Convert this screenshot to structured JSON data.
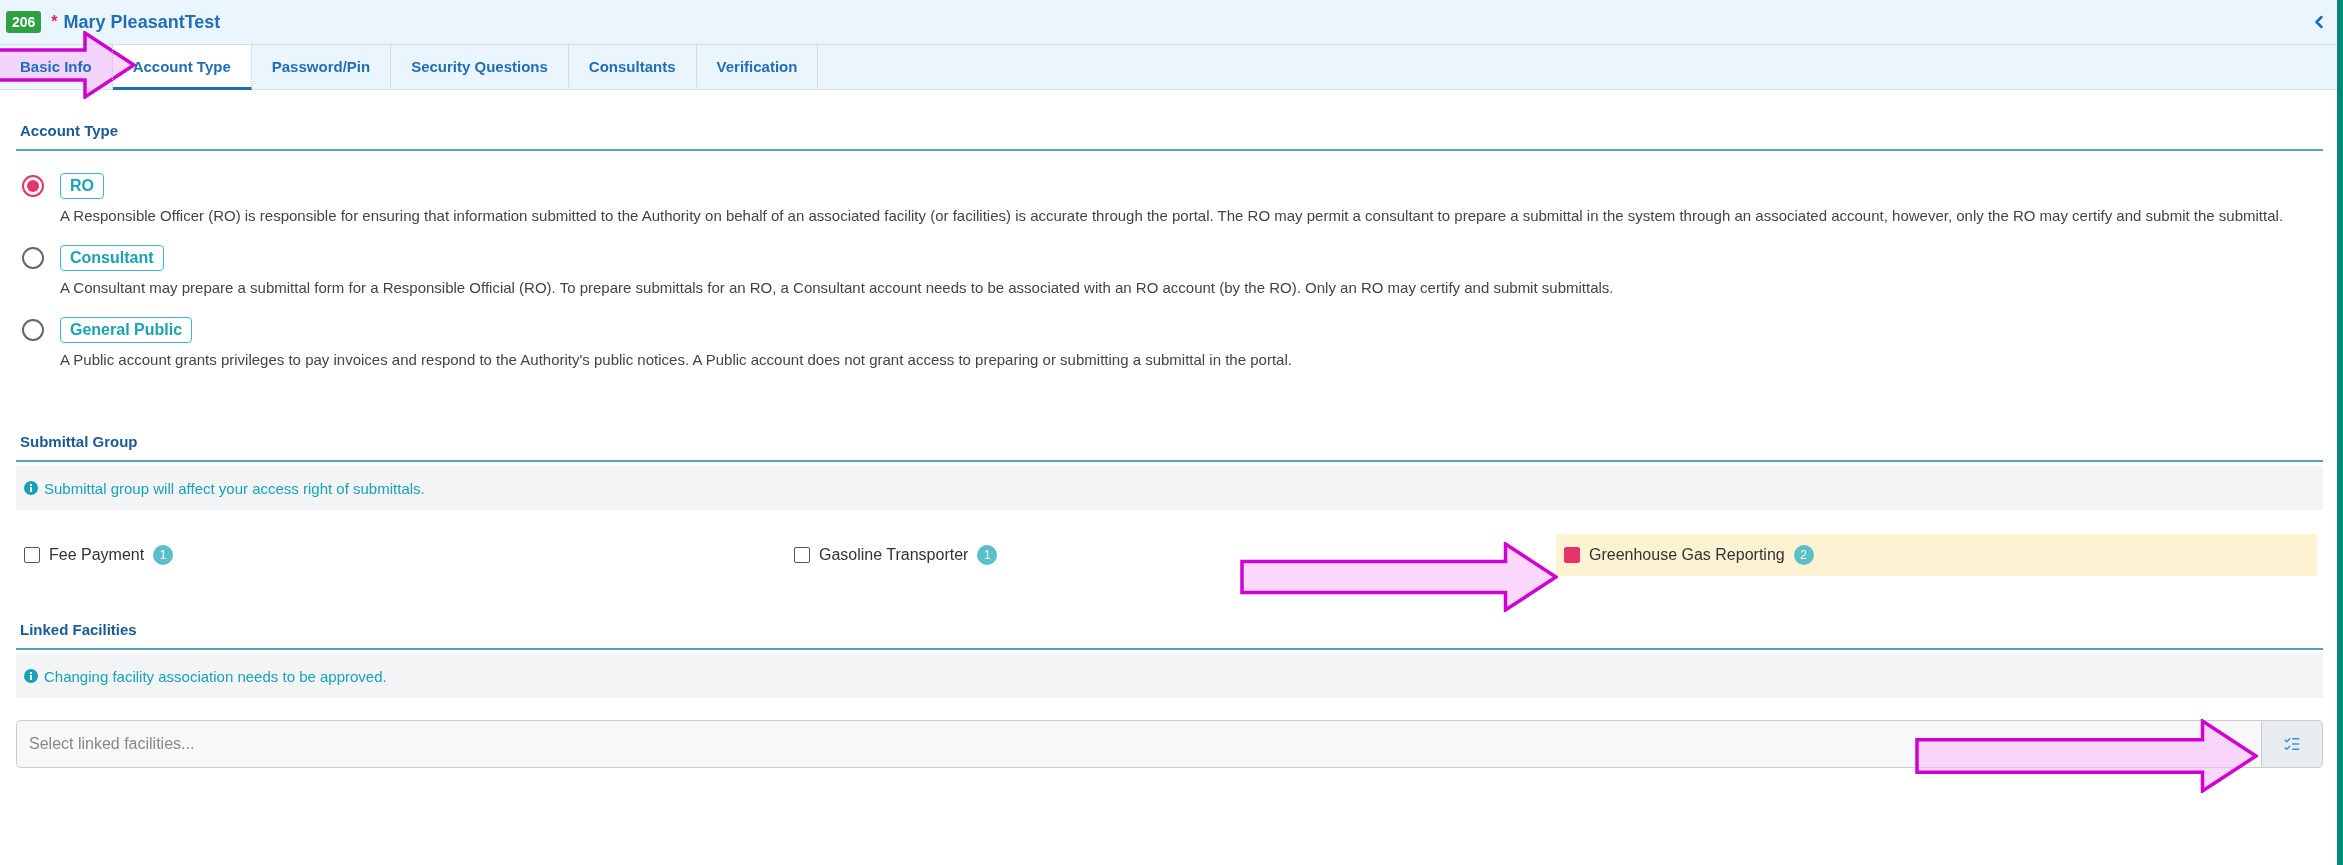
{
  "header": {
    "id_badge": "206",
    "required_mark": "*",
    "name": "Mary PleasantTest"
  },
  "tabs": [
    {
      "label": "Basic Info",
      "selected": false
    },
    {
      "label": "Account Type",
      "selected": true
    },
    {
      "label": "Password/Pin",
      "selected": false
    },
    {
      "label": "Security Questions",
      "selected": false
    },
    {
      "label": "Consultants",
      "selected": false
    },
    {
      "label": "Verification",
      "selected": false
    }
  ],
  "account_type": {
    "title": "Account Type",
    "options": [
      {
        "label": "RO",
        "selected": true,
        "description": "A Responsible Officer (RO) is responsible for ensuring that information submitted to the Authority on behalf of an associated facility (or facilities) is accurate through the portal. The RO may permit a consultant to prepare a submittal in the system through an associated account, however, only the RO may certify and submit the submittal."
      },
      {
        "label": "Consultant",
        "selected": false,
        "description": "A Consultant may prepare a submittal form for a Responsible Official (RO). To prepare submittals for an RO, a Consultant account needs to be associated with an RO account (by the RO). Only an RO may certify and submit submittals."
      },
      {
        "label": "General Public",
        "selected": false,
        "description": "A Public account grants privileges to pay invoices and respond to the Authority's public notices. A Public account does not grant access to preparing or submitting a submittal in the portal."
      }
    ]
  },
  "submittal_group": {
    "title": "Submittal Group",
    "info": "Submittal group will affect your access right of submittals.",
    "groups": [
      {
        "label": "Fee Payment",
        "count": "1",
        "checked": false
      },
      {
        "label": "Gasoline Transporter",
        "count": "1",
        "checked": false
      },
      {
        "label": "Greenhouse Gas Reporting",
        "count": "2",
        "checked": true
      }
    ]
  },
  "linked_facilities": {
    "title": "Linked Facilities",
    "info": "Changing facility association needs to be approved.",
    "placeholder": "Select linked facilities..."
  },
  "annotations": [
    {
      "kind": "arrow"
    },
    {
      "kind": "arrow"
    },
    {
      "kind": "arrow"
    }
  ]
}
